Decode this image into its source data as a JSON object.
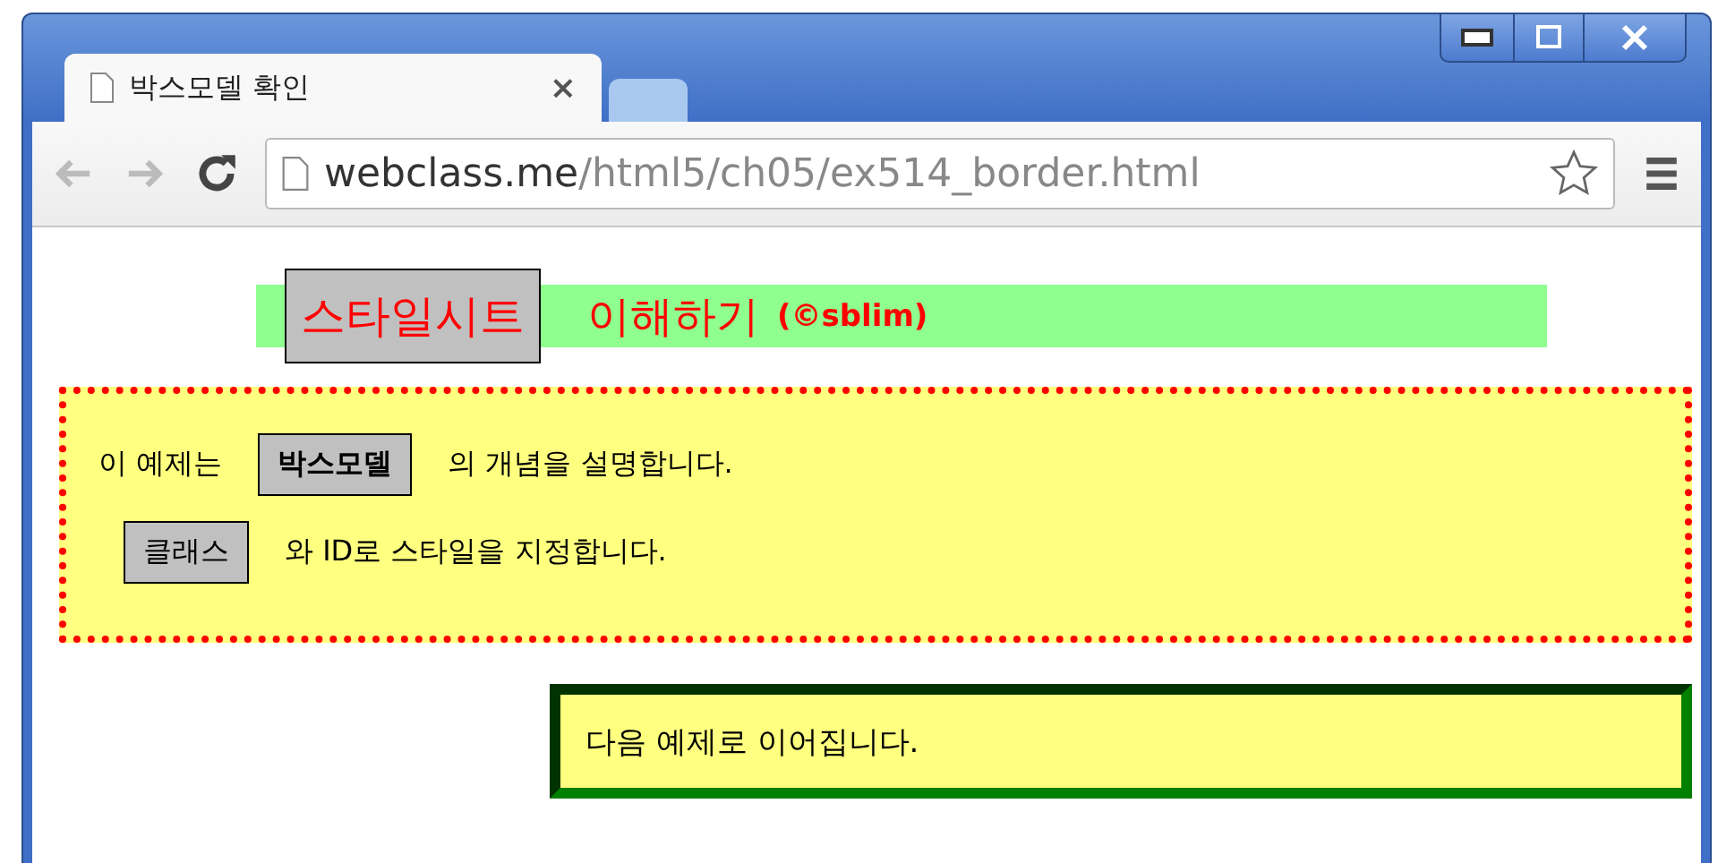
{
  "window": {
    "controls": [
      {
        "kind": "minimize"
      },
      {
        "kind": "maximize"
      },
      {
        "kind": "close"
      }
    ]
  },
  "tabs": [
    {
      "title": "박스모델 확인",
      "close": "×",
      "selected": true
    },
    {
      "selected": false
    }
  ],
  "address_bar": {
    "host": "webclass.me",
    "path": "/html5/ch05/ex514_border.html"
  },
  "page": {
    "heading": {
      "boxed": "스타일시트",
      "rest": "이해하기",
      "credit": "(©sblim)"
    },
    "notice": [
      {
        "before": "이 예제는",
        "tag": "박스모델",
        "tag_bold": true,
        "after": "의 개념을 설명합니다."
      },
      {
        "tag": "클래스",
        "tag_bold": false,
        "after": "와 ID로 스타일을 지정합니다."
      }
    ],
    "next": "다음 예제로 이어집니다."
  }
}
